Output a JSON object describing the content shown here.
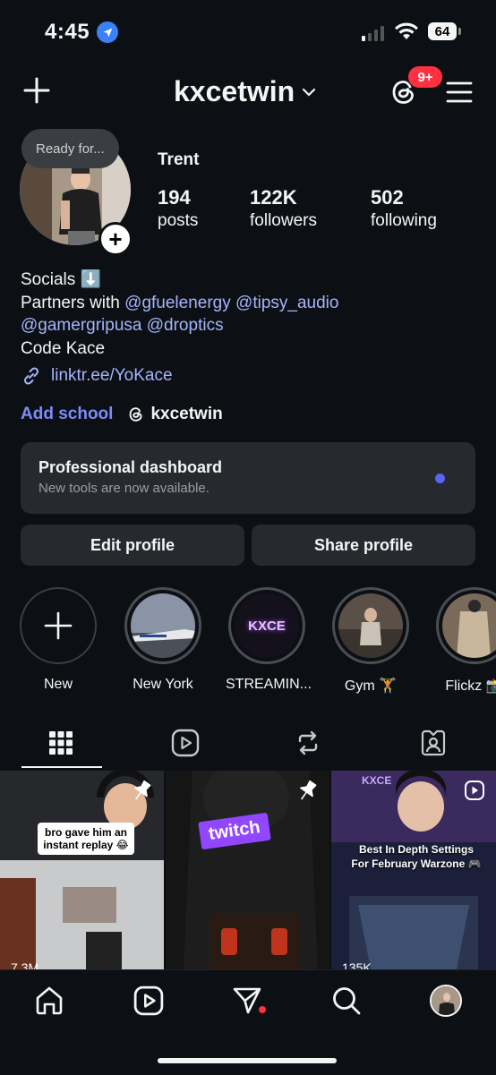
{
  "status_bar": {
    "time": "4:45",
    "battery": "64"
  },
  "header": {
    "username": "kxcetwin",
    "notification_badge": "9+"
  },
  "profile": {
    "note": "Ready for...",
    "display_name": "Trent",
    "stats": [
      {
        "value": "194",
        "label": "posts"
      },
      {
        "value": "122K",
        "label": "followers"
      },
      {
        "value": "502",
        "label": "following"
      }
    ],
    "bio": {
      "line1": "Socials ⬇️",
      "partners_prefix": "Partners with",
      "mentions": [
        "@gfuelenergy",
        "@tipsy_audio",
        "@gamergripusa",
        "@droptics"
      ],
      "line4": "Code Kace"
    },
    "link": "linktr.ee/YoKace",
    "add_school": "Add school",
    "threads_handle": "kxcetwin"
  },
  "dashboard": {
    "title": "Professional dashboard",
    "subtitle": "New tools are now available."
  },
  "buttons": {
    "edit": "Edit profile",
    "share": "Share profile"
  },
  "highlights": [
    {
      "label": "New"
    },
    {
      "label": "New York"
    },
    {
      "label": "STREAMIN...",
      "logo_text": "KXCE"
    },
    {
      "label": "Gym 🏋️"
    },
    {
      "label": "Flickz 📸"
    }
  ],
  "posts": [
    {
      "caption": "bro gave him an instant replay 😂",
      "views": "7.3M",
      "pinned": true
    },
    {
      "sign_text": "twitch",
      "pinned": true
    },
    {
      "caption": "Best In Depth Settings For February Warzone 🎮",
      "logo_text": "KXCE",
      "views": "135K",
      "pinned": false
    }
  ],
  "colors": {
    "background": "#0c1014",
    "mention": "#a5b4fc",
    "accent": "#5865f2",
    "badge": "#ff3040"
  }
}
